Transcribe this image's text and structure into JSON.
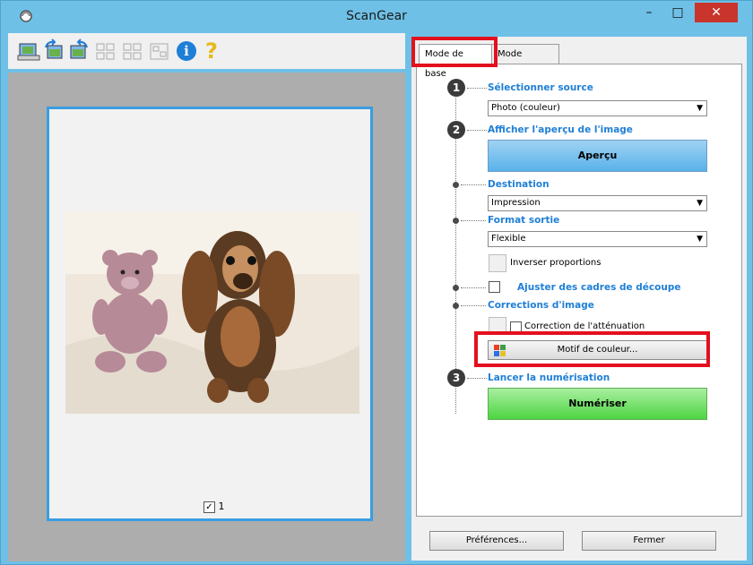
{
  "window": {
    "title": "ScanGear",
    "min_symbol": "–",
    "max_symbol": "□",
    "close_symbol": "✕"
  },
  "toolbar": {
    "tools": [
      "scan-image-icon",
      "rotate-left-icon",
      "rotate-right-icon",
      "thumbnail-view-icon",
      "grid-view-icon",
      "crop-frame-icon",
      "info-icon",
      "help-icon"
    ],
    "info_glyph": "i",
    "help_glyph": "?"
  },
  "preview": {
    "thumb_checkbox_mark": "✓",
    "thumb_number": "1"
  },
  "tabs": [
    {
      "label": "Mode de base",
      "active": true
    },
    {
      "label": "Mode avancé",
      "active": false
    }
  ],
  "steps": {
    "step1": {
      "num": "1",
      "label": "Sélectionner source",
      "value": "Photo (couleur)"
    },
    "step2": {
      "num": "2",
      "label": "Afficher l'aperçu de l'image",
      "button": "Aperçu"
    },
    "destination": {
      "label": "Destination",
      "value": "Impression"
    },
    "format": {
      "label": "Format sortie",
      "value": "Flexible",
      "swap_label": "Inverser proportions"
    },
    "crop": {
      "label": "Ajuster des cadres de découpe"
    },
    "corrections": {
      "label": "Corrections d'image",
      "fade_label": "Correction de l'atténuation",
      "color_button": "Motif de couleur..."
    },
    "step3": {
      "num": "3",
      "label": "Lancer la numérisation",
      "button": "Numériser"
    }
  },
  "footer": {
    "preferences": "Préférences...",
    "close": "Fermer"
  },
  "colors": {
    "accent": "#1f7fd6",
    "highlight": "#e3101e",
    "window_frame": "#6fc0e6",
    "preview_button": "#59b2ea",
    "scan_button": "#4ed443"
  }
}
